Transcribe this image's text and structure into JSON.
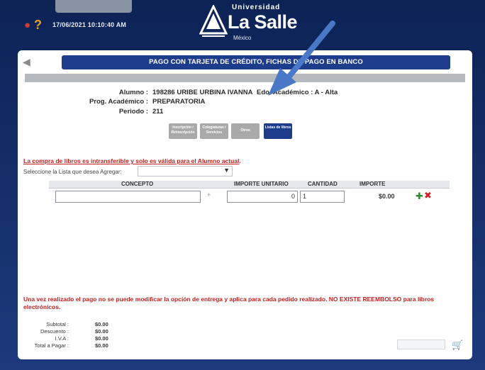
{
  "header": {
    "datetime": "17/06/2021 10:10:40 AM",
    "logo_top": "Universidad",
    "logo_main": "La Salle",
    "logo_country": "México"
  },
  "panel": {
    "title": "PAGO CON TARJETA DE CRÉDITO, FICHAS DE PAGO EN BANCO"
  },
  "student": {
    "alumno_label": "Alumno :",
    "alumno_value": "198286 URIBE URBINA IVANNA",
    "edo_label": "Edo. Académico : A - Alta",
    "prog_label": "Prog. Académico :",
    "prog_value": "PREPARATORIA",
    "periodo_label": "Periodo :",
    "periodo_value": "211"
  },
  "tabs": [
    {
      "label": "Inscripción / Reinscripción"
    },
    {
      "label": "Colegiaturas / Servicios"
    },
    {
      "label": "Otros"
    },
    {
      "label": "Listas de libros"
    }
  ],
  "books": {
    "warning_underlined": "La compra de libros es intransferible y solo es válida para el Alumno actual",
    "warning_suffix": ".",
    "select_label": "Seleccione la Lista que desea Agregar:",
    "select_value": "",
    "columns": [
      "CONCEPTO",
      "IMPORTE UNITARIO",
      "CANTIDAD",
      "IMPORTE"
    ],
    "row": {
      "concepto": "",
      "importe_unitario": "0",
      "cantidad": "1",
      "importe": "$0.00"
    }
  },
  "refund_note": "Una vez realizado el pago no se puede modificar la opción de entrega y aplica para cada pedido realizado. NO EXISTE REEMBOLSO para libros electrónicos.",
  "totals": [
    {
      "label": "Subtotal :",
      "value": "$0.00"
    },
    {
      "label": "Descuento :",
      "value": "$0.00"
    },
    {
      "label": "I.V.A :",
      "value": "$0.00"
    },
    {
      "label": "Total a Pagar :",
      "value": "$0.00"
    }
  ],
  "colors": {
    "brand_navy": "#1d3c8c",
    "warning_red": "#c41f1f",
    "annotation_arrow": "#4a78c8"
  }
}
